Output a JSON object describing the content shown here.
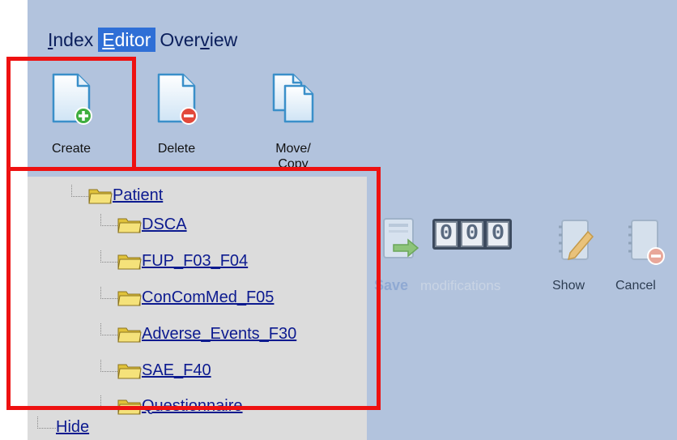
{
  "menu": {
    "tabs": [
      {
        "pre": "",
        "u": "I",
        "post": "ndex"
      },
      {
        "pre": "",
        "u": "E",
        "post": "ditor"
      },
      {
        "pre": "Over",
        "u": "v",
        "post": "iew"
      }
    ],
    "active_tab": "Editor"
  },
  "toolbar": {
    "create_label": "Create",
    "delete_label": "Delete",
    "move_label_line1": "Move/",
    "move_label_line2": "Copy"
  },
  "tree": {
    "root": "Patient",
    "children": [
      "DSCA",
      "FUP_F03_F04",
      "ConComMed_F05",
      "Adverse_Events_F30",
      "SAE_F40",
      "Questionnaire"
    ],
    "hide_label": "Hide"
  },
  "right_toolbar": {
    "counter_digits": [
      "0",
      "0",
      "0"
    ],
    "save_label": "Save",
    "modifications_label": "modifications",
    "show_label": "Show",
    "cancel_label": "Cancel"
  },
  "colors": {
    "panel_bg": "#b2c3dd",
    "tree_bg": "#dcdcdc",
    "active_tab": "#2f6fd6",
    "highlight": "#ee1111",
    "link": "#0c1a8f"
  },
  "icons": [
    "create-document-icon",
    "delete-document-icon",
    "copy-document-icon",
    "folder-icon",
    "save-arrow-icon",
    "notebook-pencil-icon",
    "notebook-cancel-icon"
  ]
}
